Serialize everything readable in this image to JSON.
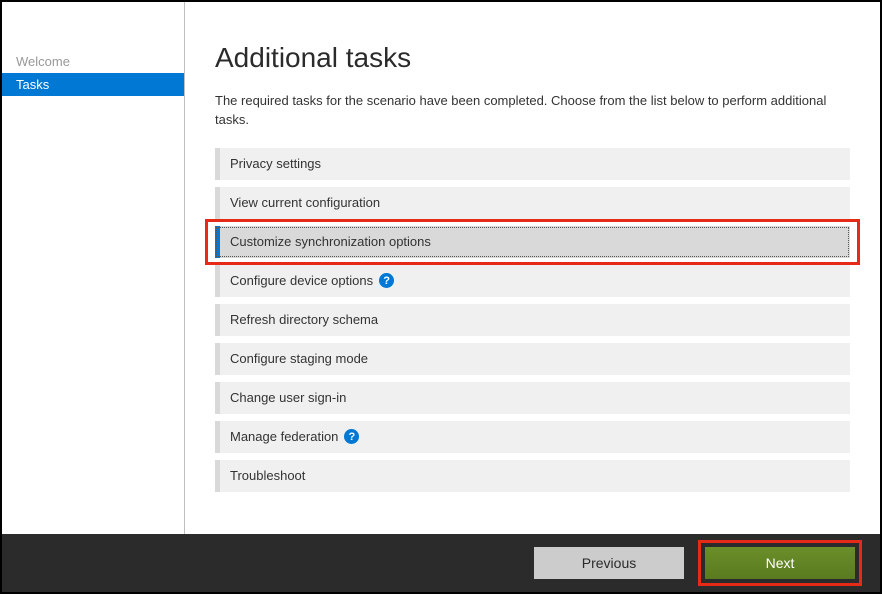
{
  "sidebar": {
    "items": [
      {
        "label": "Welcome",
        "active": false
      },
      {
        "label": "Tasks",
        "active": true
      }
    ]
  },
  "main": {
    "title": "Additional tasks",
    "description": "The required tasks for the scenario have been completed. Choose from the list below to perform additional tasks.",
    "tasks": [
      {
        "label": "Privacy settings",
        "help": false,
        "selected": false,
        "highlighted": false
      },
      {
        "label": "View current configuration",
        "help": false,
        "selected": false,
        "highlighted": false
      },
      {
        "label": "Customize synchronization options",
        "help": false,
        "selected": true,
        "highlighted": true
      },
      {
        "label": "Configure device options",
        "help": true,
        "selected": false,
        "highlighted": false
      },
      {
        "label": "Refresh directory schema",
        "help": false,
        "selected": false,
        "highlighted": false
      },
      {
        "label": "Configure staging mode",
        "help": false,
        "selected": false,
        "highlighted": false
      },
      {
        "label": "Change user sign-in",
        "help": false,
        "selected": false,
        "highlighted": false
      },
      {
        "label": "Manage federation",
        "help": true,
        "selected": false,
        "highlighted": false
      },
      {
        "label": "Troubleshoot",
        "help": false,
        "selected": false,
        "highlighted": false
      }
    ]
  },
  "footer": {
    "previous_label": "Previous",
    "next_label": "Next"
  },
  "help_glyph": "?"
}
